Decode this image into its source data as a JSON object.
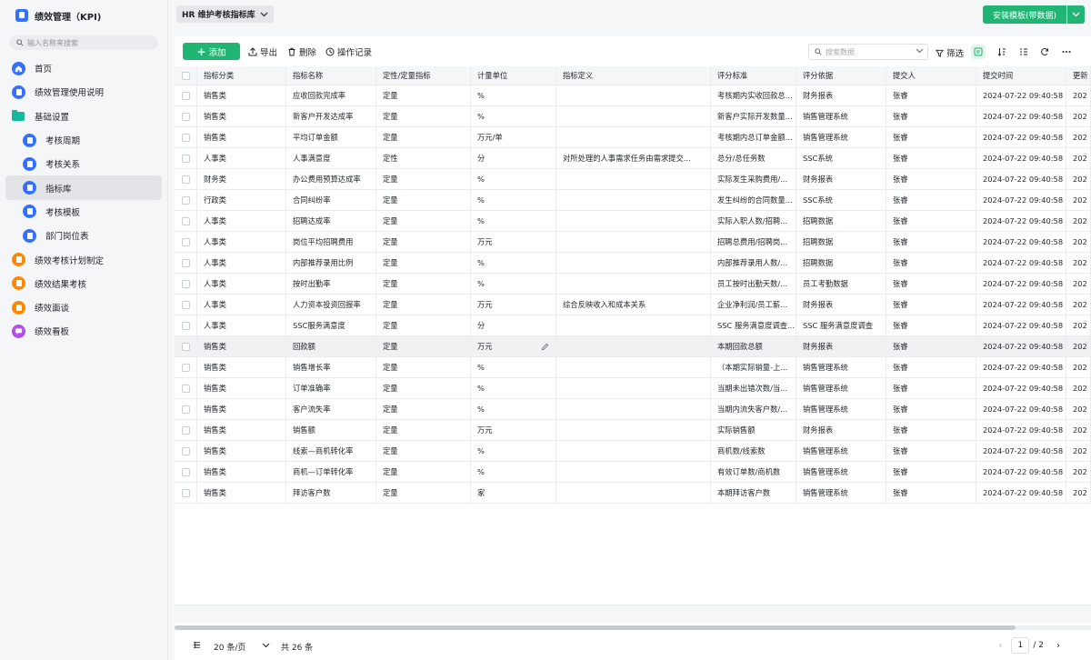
{
  "app": {
    "title": "绩效管理（KPI)",
    "search_placeholder": "输入名称来搜索"
  },
  "sidebar": {
    "items": [
      {
        "label": "首页",
        "icon": "home-icon",
        "color": "#3370ff",
        "level": 0
      },
      {
        "label": "绩效管理使用说明",
        "icon": "doc-icon",
        "color": "#3370ff",
        "level": 0
      },
      {
        "label": "基础设置",
        "icon": "folder-icon",
        "color": "#16b89c",
        "level": 0
      },
      {
        "label": "考核周期",
        "icon": "doc-icon",
        "color": "#3370ff",
        "level": 1
      },
      {
        "label": "考核关系",
        "icon": "doc-icon",
        "color": "#3370ff",
        "level": 1
      },
      {
        "label": "指标库",
        "icon": "doc-icon",
        "color": "#3370ff",
        "level": 1,
        "active": true
      },
      {
        "label": "考核模板",
        "icon": "doc-icon",
        "color": "#3370ff",
        "level": 1
      },
      {
        "label": "部门岗位表",
        "icon": "doc-icon",
        "color": "#3370ff",
        "level": 1
      },
      {
        "label": "绩效考核计划制定",
        "icon": "doc-icon",
        "color": "#ff8800",
        "level": 0
      },
      {
        "label": "绩效结果考核",
        "icon": "doc-icon",
        "color": "#ff8800",
        "level": 0
      },
      {
        "label": "绩效面谈",
        "icon": "doc-icon",
        "color": "#ff8800",
        "level": 0
      },
      {
        "label": "绩效看板",
        "icon": "chat-icon",
        "color": "#b34fe6",
        "level": 0
      }
    ]
  },
  "topbar": {
    "view_name": "HR 维护考核指标库",
    "install_label": "安装模板(带数据)"
  },
  "toolbar": {
    "add_label": "添加",
    "export_label": "导出",
    "delete_label": "删除",
    "history_label": "操作记录",
    "search_placeholder": "搜索数据",
    "filter_label": "筛选"
  },
  "table": {
    "columns": [
      "指标分类",
      "指标名称",
      "定性/定量指标",
      "计量单位",
      "指标定义",
      "评分标准",
      "评分依据",
      "提交人",
      "提交时间",
      "更新"
    ],
    "rows": [
      [
        "销售类",
        "应收回款完成率",
        "定量",
        "%",
        "",
        "考核期内实收回款总...",
        "财务报表",
        "张睿",
        "2024-07-22 09:40:58",
        "202"
      ],
      [
        "销售类",
        "新客户开发达成率",
        "定量",
        "%",
        "",
        "新客户实际开发数量...",
        "销售管理系统",
        "张睿",
        "2024-07-22 09:40:58",
        "202"
      ],
      [
        "销售类",
        "平均订单金额",
        "定量",
        "万元/单",
        "",
        "考核期内总订单金额...",
        "销售管理系统",
        "张睿",
        "2024-07-22 09:40:58",
        "202"
      ],
      [
        "人事类",
        "人事满意度",
        "定性",
        "分",
        "对所处理的人事需求任务由需求提交...",
        "总分/总任务数",
        "SSC系统",
        "张睿",
        "2024-07-22 09:40:58",
        "202"
      ],
      [
        "财务类",
        "办公费用预算达成率",
        "定量",
        "%",
        "",
        "实际发生采购费用/...",
        "财务报表",
        "张睿",
        "2024-07-22 09:40:58",
        "202"
      ],
      [
        "行政类",
        "合同纠纷率",
        "定量",
        "%",
        "",
        "发生纠纷的合同数量...",
        "SSC系统",
        "张睿",
        "2024-07-22 09:40:58",
        "202"
      ],
      [
        "人事类",
        "招聘达成率",
        "定量",
        "%",
        "",
        "实际入职人数/招聘...",
        "招聘数据",
        "张睿",
        "2024-07-22 09:40:58",
        "202"
      ],
      [
        "人事类",
        "岗位平均招聘费用",
        "定量",
        "万元",
        "",
        "招聘总费用/招聘岗...",
        "招聘数据",
        "张睿",
        "2024-07-22 09:40:58",
        "202"
      ],
      [
        "人事类",
        "内部推荐录用比例",
        "定量",
        "%",
        "",
        "内部推荐录用人数/...",
        "招聘数据",
        "张睿",
        "2024-07-22 09:40:58",
        "202"
      ],
      [
        "人事类",
        "按时出勤率",
        "定量",
        "%",
        "",
        "员工按时出勤天数/...",
        "员工考勤数据",
        "张睿",
        "2024-07-22 09:40:58",
        "202"
      ],
      [
        "人事类",
        "人力资本投资回报率",
        "定量",
        "万元",
        "综合反映收入和成本关系",
        "企业净利润/员工薪...",
        "财务报表",
        "张睿",
        "2024-07-22 09:40:58",
        "202"
      ],
      [
        "人事类",
        "SSC服务满意度",
        "定量",
        "分",
        "",
        "SSC 服务满意度调查...",
        "SSC 服务满意度调查",
        "张睿",
        "2024-07-22 09:40:58",
        "202"
      ],
      [
        "销售类",
        "回款额",
        "定量",
        "万元",
        "",
        "本期回款总额",
        "财务报表",
        "张睿",
        "2024-07-22 09:40:58",
        "202"
      ],
      [
        "销售类",
        "销售增长率",
        "定量",
        "%",
        "",
        "（本期实际销量-上...",
        "销售管理系统",
        "张睿",
        "2024-07-22 09:40:58",
        "202"
      ],
      [
        "销售类",
        "订单准确率",
        "定量",
        "%",
        "",
        "当期未出错次数/当...",
        "销售管理系统",
        "张睿",
        "2024-07-22 09:40:58",
        "202"
      ],
      [
        "销售类",
        "客户流失率",
        "定量",
        "%",
        "",
        "当期内流失客户数/...",
        "销售管理系统",
        "张睿",
        "2024-07-22 09:40:58",
        "202"
      ],
      [
        "销售类",
        "销售额",
        "定量",
        "万元",
        "",
        "实际销售额",
        "财务报表",
        "张睿",
        "2024-07-22 09:40:58",
        "202"
      ],
      [
        "销售类",
        "线索—商机转化率",
        "定量",
        "%",
        "",
        "商机数/线索数",
        "销售管理系统",
        "张睿",
        "2024-07-22 09:40:58",
        "202"
      ],
      [
        "销售类",
        "商机—订单转化率",
        "定量",
        "%",
        "",
        "有效订单数/商机数",
        "销售管理系统",
        "张睿",
        "2024-07-22 09:40:58",
        "202"
      ],
      [
        "销售类",
        "拜访客户数",
        "定量",
        "家",
        "",
        "本期拜访客户数",
        "销售管理系统",
        "张睿",
        "2024-07-22 09:40:58",
        "202"
      ]
    ],
    "hover_row": 12
  },
  "footer": {
    "per_page": "20 条/页",
    "total": "共 26 条",
    "current_page": "1",
    "total_pages": "/ 2"
  },
  "colors": {
    "accent": "#21b573",
    "primary": "#3370ff"
  }
}
